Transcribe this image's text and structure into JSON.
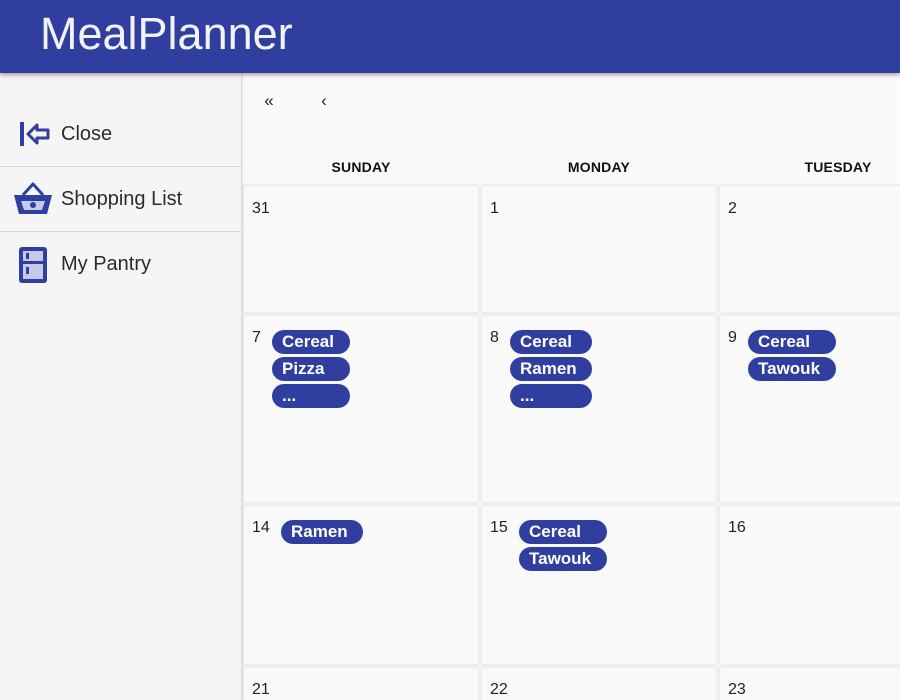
{
  "app": {
    "title": "MealPlanner"
  },
  "sidebar": {
    "items": [
      {
        "label": "Close",
        "icon": "close-drawer-icon"
      },
      {
        "label": "Shopping List",
        "icon": "basket-icon"
      },
      {
        "label": "My Pantry",
        "icon": "fridge-icon"
      }
    ]
  },
  "calendar": {
    "nav": {
      "first": "«",
      "prev": "‹"
    },
    "days": [
      "SUNDAY",
      "MONDAY",
      "TUESDAY"
    ],
    "weeks": [
      [
        {
          "date": "31",
          "meals": []
        },
        {
          "date": "1",
          "meals": []
        },
        {
          "date": "2",
          "meals": []
        }
      ],
      [
        {
          "date": "7",
          "meals": [
            "Cereal",
            "Pizza",
            "..."
          ]
        },
        {
          "date": "8",
          "meals": [
            "Cereal",
            "Ramen",
            "..."
          ]
        },
        {
          "date": "9",
          "meals": [
            "Cereal",
            "Tawouk"
          ]
        }
      ],
      [
        {
          "date": "14",
          "meals": [
            "Ramen"
          ]
        },
        {
          "date": "15",
          "meals": [
            "Cereal",
            "Tawouk"
          ]
        },
        {
          "date": "16",
          "meals": []
        }
      ],
      [
        {
          "date": "21",
          "meals": []
        },
        {
          "date": "22",
          "meals": []
        },
        {
          "date": "23",
          "meals": []
        }
      ]
    ]
  },
  "colors": {
    "primary": "#303f9f",
    "background": "#fafafa",
    "sidebar": "#f5f5f5"
  }
}
